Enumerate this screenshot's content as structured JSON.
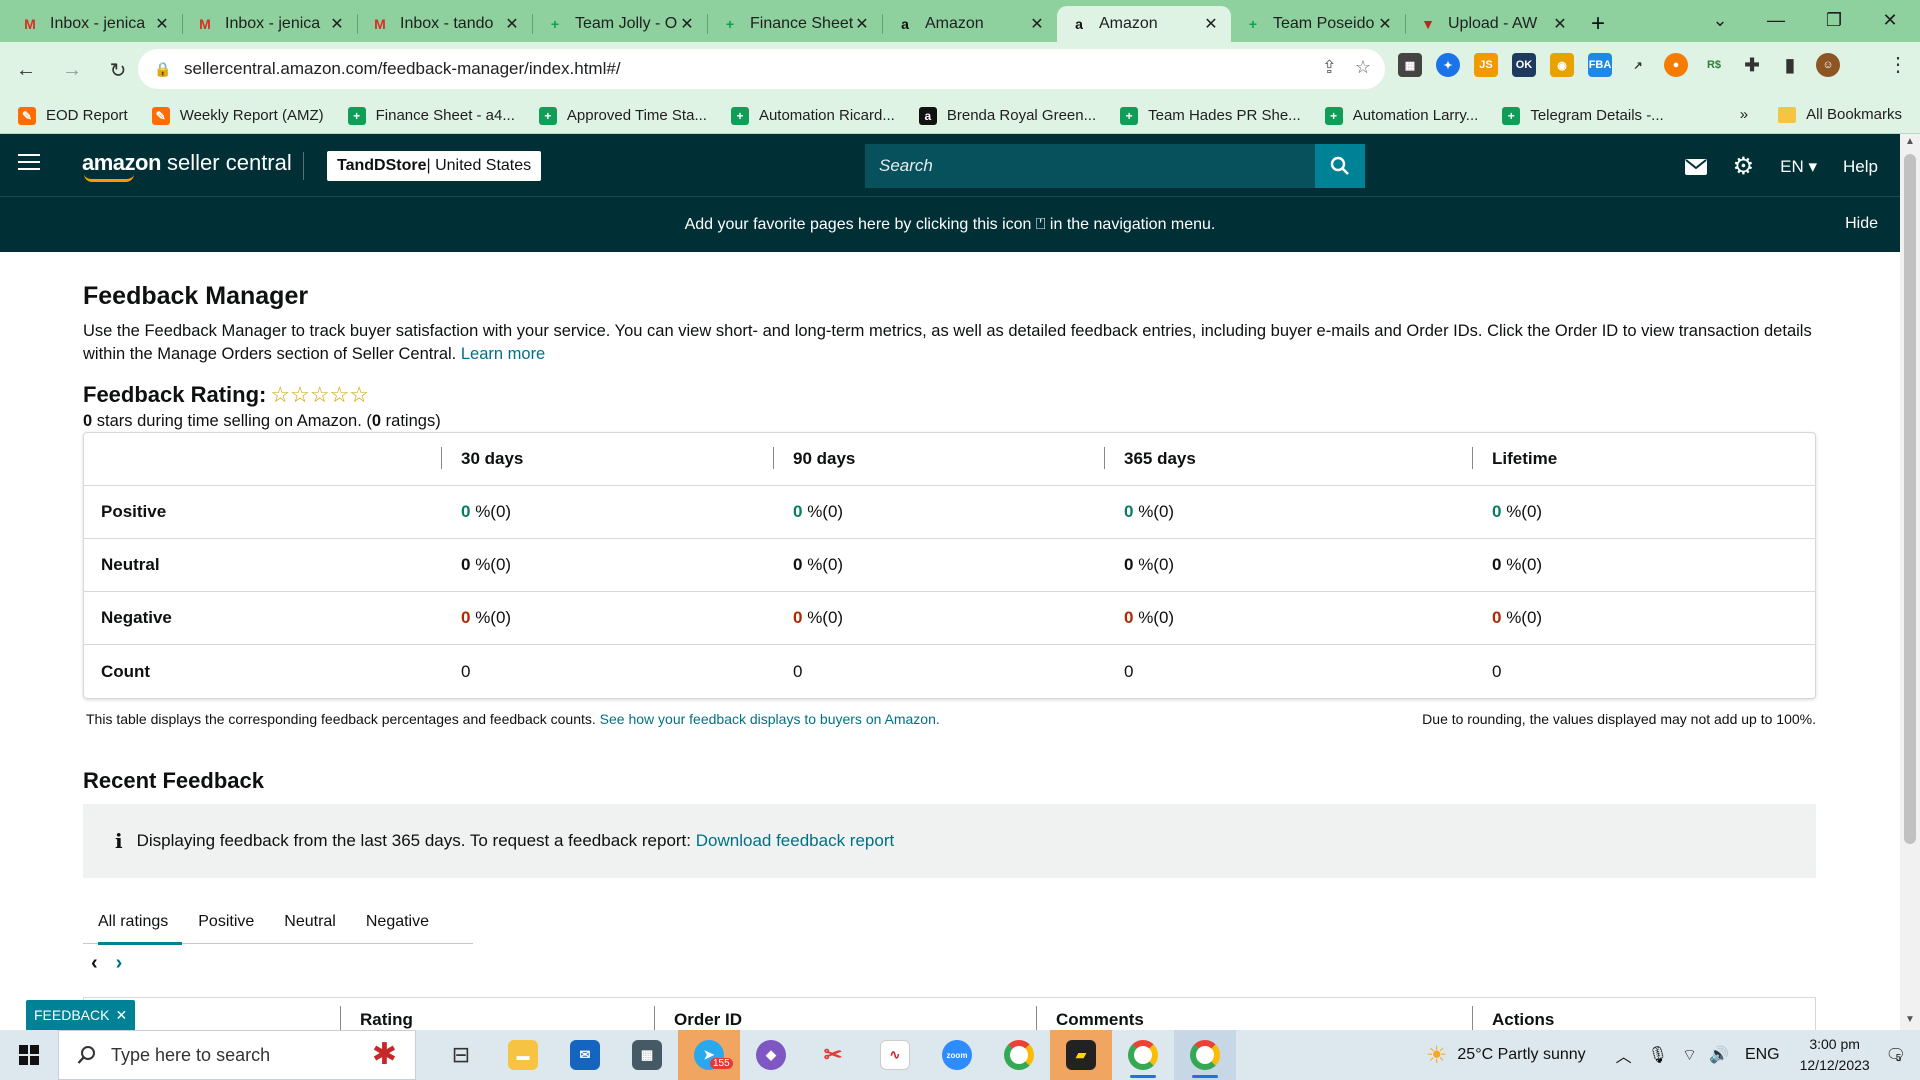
{
  "browser": {
    "tabs": [
      {
        "title": "Inbox - jenica",
        "icon": "gmail-icon",
        "color": "#d93025",
        "glyph": "M",
        "active": false
      },
      {
        "title": "Inbox - jenica",
        "icon": "gmail-icon",
        "color": "#d93025",
        "glyph": "M",
        "active": false
      },
      {
        "title": "Inbox - tando",
        "icon": "gmail-icon",
        "color": "#d93025",
        "glyph": "M",
        "active": false
      },
      {
        "title": "Team Jolly - O",
        "icon": "sheets-icon",
        "color": "#0f9d58",
        "glyph": "+",
        "active": false
      },
      {
        "title": "Finance Sheet",
        "icon": "sheets-icon",
        "color": "#0f9d58",
        "glyph": "+",
        "active": false
      },
      {
        "title": "Amazon",
        "icon": "amazon-icon",
        "color": "#111111",
        "glyph": "a",
        "active": false
      },
      {
        "title": "Amazon",
        "icon": "amazon-icon",
        "color": "#111111",
        "glyph": "a",
        "active": true
      },
      {
        "title": "Team Poseido",
        "icon": "sheets-icon",
        "color": "#0f9d58",
        "glyph": "+",
        "active": false
      },
      {
        "title": "Upload - AW",
        "icon": "upload-icon",
        "color": "#c5221f",
        "glyph": "▼",
        "active": false
      }
    ],
    "url": "sellercentral.amazon.com/feedback-manager/index.html#/",
    "bookmarks": [
      {
        "label": "EOD Report",
        "color": "#ff6d00",
        "glyph": "✎"
      },
      {
        "label": "Weekly Report (AMZ)",
        "color": "#ff6d00",
        "glyph": "✎"
      },
      {
        "label": "Finance Sheet - a4...",
        "color": "#0f9d58",
        "glyph": "+"
      },
      {
        "label": "Approved Time Sta...",
        "color": "#0f9d58",
        "glyph": "+"
      },
      {
        "label": "Automation Ricard...",
        "color": "#0f9d58",
        "glyph": "+"
      },
      {
        "label": "Brenda Royal Green...",
        "color": "#111111",
        "glyph": "a"
      },
      {
        "label": "Team Hades PR She...",
        "color": "#0f9d58",
        "glyph": "+"
      },
      {
        "label": "Automation Larry...",
        "color": "#0f9d58",
        "glyph": "+"
      },
      {
        "label": "Telegram Details -...",
        "color": "#0f9d58",
        "glyph": "+"
      }
    ],
    "bookmarks_more": "»",
    "all_bookmarks": "All Bookmarks"
  },
  "header": {
    "logo_amazon": "amazon",
    "logo_rest": " seller central",
    "store_name": "TandDStore",
    "store_region": " | United States",
    "search_placeholder": "Search",
    "language": "EN",
    "help": "Help"
  },
  "banner": {
    "text": "Add your favorite pages here by clicking this icon ⍞ in the navigation menu.",
    "hide": "Hide"
  },
  "page": {
    "title": "Feedback Manager",
    "description": "Use the Feedback Manager to track buyer satisfaction with your service. You can view short- and long-term metrics, as well as detailed feedback entries, including buyer e-mails and Order IDs. Click the Order ID to view transaction details within the Manage Orders section of Seller Central.",
    "learn_more": "Learn more",
    "rating_label": "Feedback Rating:",
    "stars": "☆☆☆☆☆",
    "rating_stars_value": "0",
    "rating_mid": " stars during time selling on Amazon. (",
    "rating_count": "0",
    "rating_end": " ratings)"
  },
  "table": {
    "columns": [
      "",
      "30 days",
      "90 days",
      "365 days",
      "Lifetime"
    ],
    "rows": [
      {
        "label": "Positive",
        "tone": "g",
        "cells": [
          {
            "n": "0",
            "s": " %(0)"
          },
          {
            "n": "0",
            "s": " %(0)"
          },
          {
            "n": "0",
            "s": " %(0)"
          },
          {
            "n": "0",
            "s": " %(0)"
          }
        ]
      },
      {
        "label": "Neutral",
        "tone": "n",
        "cells": [
          {
            "n": "0",
            "s": " %(0)"
          },
          {
            "n": "0",
            "s": " %(0)"
          },
          {
            "n": "0",
            "s": " %(0)"
          },
          {
            "n": "0",
            "s": " %(0)"
          }
        ]
      },
      {
        "label": "Negative",
        "tone": "r",
        "cells": [
          {
            "n": "0",
            "s": " %(0)"
          },
          {
            "n": "0",
            "s": " %(0)"
          },
          {
            "n": "0",
            "s": " %(0)"
          },
          {
            "n": "0",
            "s": " %(0)"
          }
        ]
      },
      {
        "label": "Count",
        "tone": "",
        "cells": [
          {
            "n": "",
            "s": "0"
          },
          {
            "n": "",
            "s": "0"
          },
          {
            "n": "",
            "s": "0"
          },
          {
            "n": "",
            "s": "0"
          }
        ]
      }
    ],
    "note": "This table displays the corresponding feedback percentages and feedback counts.",
    "note_link": "See how your feedback displays to buyers on Amazon.",
    "note_right": "Due to rounding, the values displayed may not add up to 100%."
  },
  "recent": {
    "title": "Recent Feedback",
    "info_text": "Displaying feedback from the last 365 days. To request a feedback report:",
    "info_link": "Download feedback report",
    "tabs": [
      "All ratings",
      "Positive",
      "Neutral",
      "Negative"
    ],
    "columns": [
      ".",
      "Rating",
      "Order ID",
      "Comments",
      "Actions"
    ],
    "feedback_tag": "FEEDBACK"
  },
  "taskbar": {
    "search_placeholder": "Type here to search",
    "telegram_badge": "155",
    "weather": "25°C  Partly sunny",
    "lang": "ENG",
    "time": "3:00 pm",
    "date": "12/12/2023",
    "notif_count": "5"
  }
}
